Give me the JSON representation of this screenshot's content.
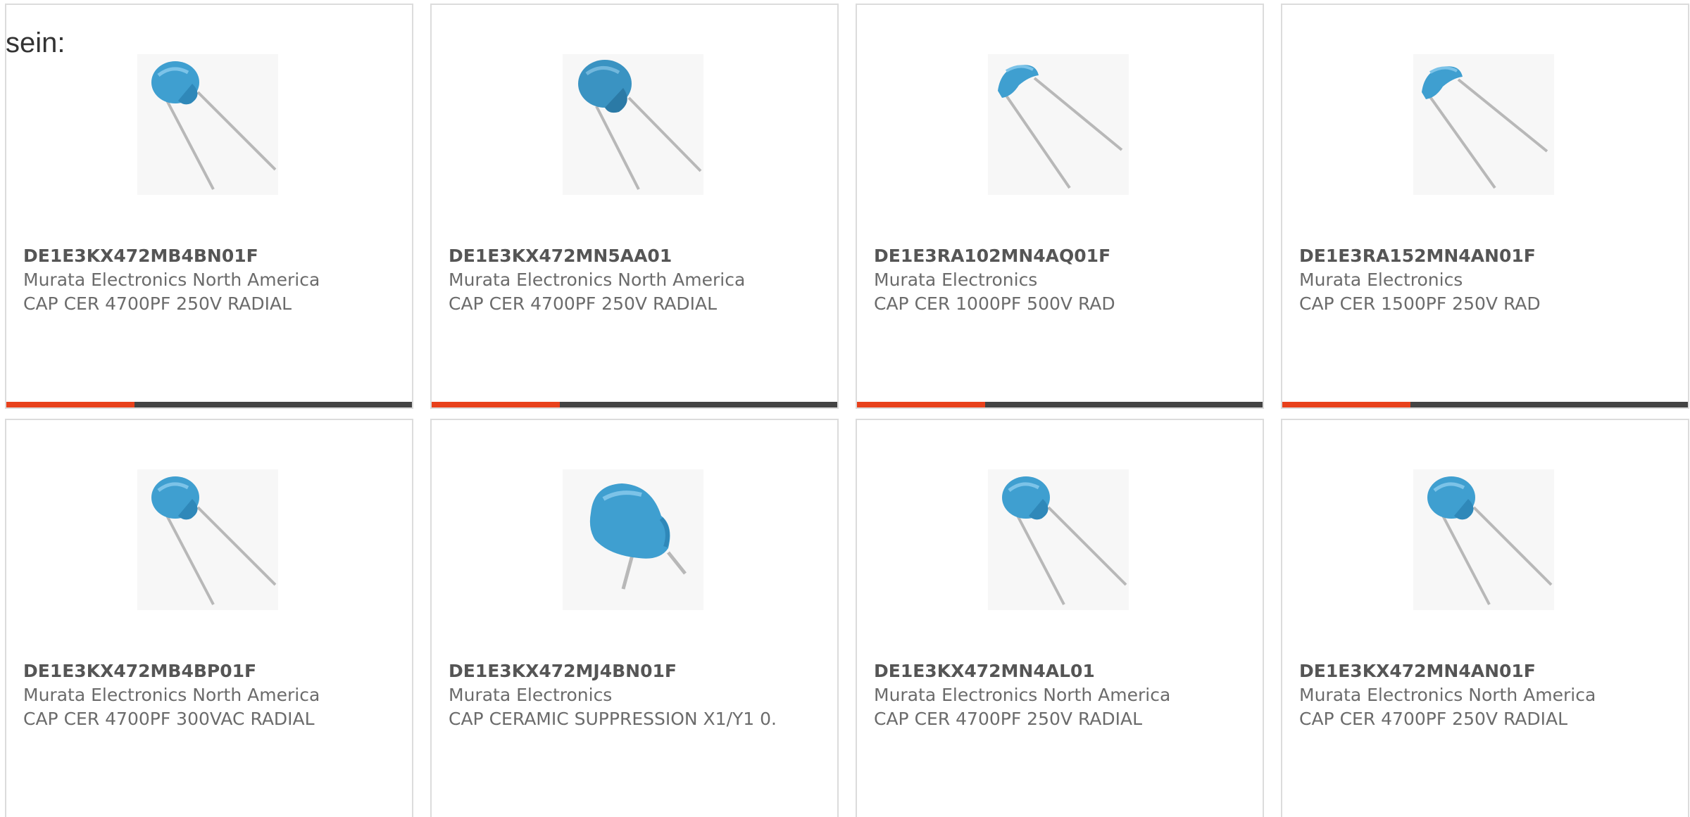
{
  "intro": {
    "text": "sein:"
  },
  "theme": {
    "accent_color": "#e8411c",
    "bar_color": "#444444",
    "capacitor_color": "#3f9fd0"
  },
  "products": [
    {
      "part_number": "DE1E3KX472MB4BN01F",
      "manufacturer": "Murata Electronics North America",
      "description": "CAP CER 4700PF 250V RADIAL",
      "image_icon": "disc-capacitor-icon"
    },
    {
      "part_number": "DE1E3KX472MN5AA01",
      "manufacturer": "Murata Electronics North America",
      "description": "CAP CER 4700PF 250V RADIAL",
      "image_icon": "disc-capacitor-icon"
    },
    {
      "part_number": "DE1E3RA102MN4AQ01F",
      "manufacturer": "Murata Electronics",
      "description": "CAP CER 1000PF 500V RAD",
      "image_icon": "small-disc-capacitor-icon"
    },
    {
      "part_number": "DE1E3RA152MN4AN01F",
      "manufacturer": "Murata Electronics",
      "description": "CAP CER 1500PF 250V RAD",
      "image_icon": "small-disc-capacitor-icon"
    },
    {
      "part_number": "DE1E3KX472MB4BP01F",
      "manufacturer": "Murata Electronics North America",
      "description": "CAP CER 4700PF 300VAC RADIAL",
      "image_icon": "disc-capacitor-icon"
    },
    {
      "part_number": "DE1E3KX472MJ4BN01F",
      "manufacturer": "Murata Electronics",
      "description": "CAP CERAMIC SUPPRESSION X1/Y1 0.",
      "image_icon": "large-disc-capacitor-icon"
    },
    {
      "part_number": "DE1E3KX472MN4AL01",
      "manufacturer": "Murata Electronics North America",
      "description": "CAP CER 4700PF 250V RADIAL",
      "image_icon": "disc-capacitor-icon"
    },
    {
      "part_number": "DE1E3KX472MN4AN01F",
      "manufacturer": "Murata Electronics North America",
      "description": "CAP CER 4700PF 250V RADIAL",
      "image_icon": "disc-capacitor-icon"
    }
  ]
}
